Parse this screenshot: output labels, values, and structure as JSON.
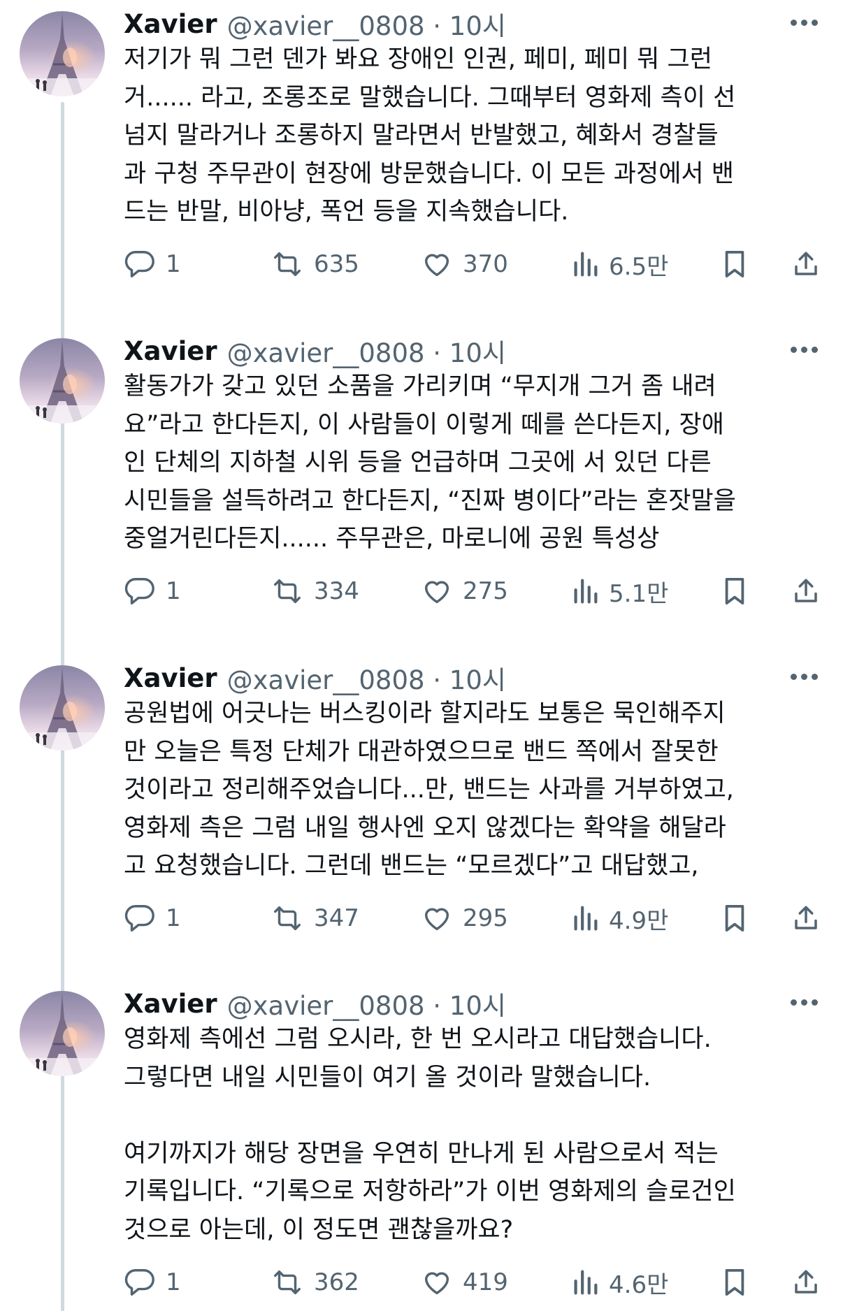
{
  "tweets": [
    {
      "name": "Xavier",
      "handle": "@xavier__0808 · 10시",
      "lines": [
        "저기가 뭐 그런 덴가 봐요 장애인 인권, 페미, 페미 뭐 그런",
        "거...... 라고, 조롱조로 말했습니다. 그때부터 영화제 측이 선",
        "넘지 말라거나 조롱하지 말라면서 반발했고, 혜화서 경찰들",
        "과 구청 주무관이 현장에 방문했습니다. 이 모든 과정에서 밴",
        "드는 반말, 비아냥, 폭언 등을 지속했습니다."
      ],
      "replies": "1",
      "retweets": "635",
      "likes": "370",
      "views": "6.5만"
    },
    {
      "name": "Xavier",
      "handle": "@xavier__0808 · 10시",
      "lines": [
        "활동가가 갖고 있던 소품을 가리키며 “무지개 그거 좀 내려",
        "요”라고 한다든지, 이 사람들이 이렇게 떼를 쓴다든지, 장애",
        "인 단체의 지하철 시위 등을 언급하며 그곳에 서 있던 다른",
        "시민들을 설득하려고 한다든지, “진짜 병이다”라는 혼잣말을",
        "중얼거린다든지...... 주무관은, 마로니에 공원 특성상"
      ],
      "replies": "1",
      "retweets": "334",
      "likes": "275",
      "views": "5.1만"
    },
    {
      "name": "Xavier",
      "handle": "@xavier__0808 · 10시",
      "lines": [
        "공원법에 어긋나는 버스킹이라 할지라도 보통은 묵인해주지",
        "만 오늘은 특정 단체가 대관하였으므로 밴드 쪽에서 잘못한",
        "것이라고 정리해주었습니다...만, 밴드는 사과를 거부하였고,",
        "영화제 측은 그럼 내일 행사엔 오지 않겠다는 확약을 해달라",
        "고 요청했습니다. 그런데 밴드는 “모르겠다”고 대답했고,"
      ],
      "replies": "1",
      "retweets": "347",
      "likes": "295",
      "views": "4.9만"
    },
    {
      "name": "Xavier",
      "handle": "@xavier__0808 · 10시",
      "lines": [
        "영화제 측에선 그럼 오시라, 한 번 오시라고 대답했습니다.",
        "그렇다면 내일 시민들이 여기 올 것이라 말했습니다.",
        "",
        "여기까지가 해당 장면을 우연히 만나게 된 사람으로서 적는",
        "기록입니다. “기록으로 저항하라”가 이번 영화제의 슬로건인",
        "것으로 아는데, 이 정도면 괜찮을까요?"
      ],
      "replies": "1",
      "retweets": "362",
      "likes": "419",
      "views": "4.6만"
    }
  ],
  "icons": {
    "avatar": "eiffel-tower-photo",
    "more": "more-dots-icon",
    "reply": "reply-bubble-icon",
    "retweet": "retweet-arrows-icon",
    "like": "heart-icon",
    "views": "bar-chart-icon",
    "bookmark": "bookmark-icon",
    "share": "share-upload-icon"
  },
  "colors": {
    "text": "#0f1419",
    "secondary": "#536471",
    "thread_line": "#cfd9de",
    "background": "#ffffff"
  }
}
